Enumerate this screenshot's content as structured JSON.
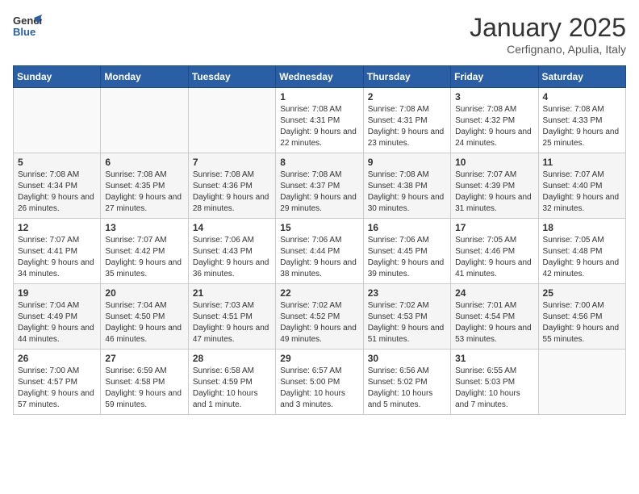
{
  "header": {
    "logo": {
      "general": "General",
      "blue": "Blue"
    },
    "month": "January 2025",
    "location": "Cerfignano, Apulia, Italy"
  },
  "weekdays": [
    "Sunday",
    "Monday",
    "Tuesday",
    "Wednesday",
    "Thursday",
    "Friday",
    "Saturday"
  ],
  "weeks": [
    [
      {
        "day": "",
        "sunrise": "",
        "sunset": "",
        "daylight": ""
      },
      {
        "day": "",
        "sunrise": "",
        "sunset": "",
        "daylight": ""
      },
      {
        "day": "",
        "sunrise": "",
        "sunset": "",
        "daylight": ""
      },
      {
        "day": "1",
        "sunrise": "Sunrise: 7:08 AM",
        "sunset": "Sunset: 4:31 PM",
        "daylight": "Daylight: 9 hours and 22 minutes."
      },
      {
        "day": "2",
        "sunrise": "Sunrise: 7:08 AM",
        "sunset": "Sunset: 4:31 PM",
        "daylight": "Daylight: 9 hours and 23 minutes."
      },
      {
        "day": "3",
        "sunrise": "Sunrise: 7:08 AM",
        "sunset": "Sunset: 4:32 PM",
        "daylight": "Daylight: 9 hours and 24 minutes."
      },
      {
        "day": "4",
        "sunrise": "Sunrise: 7:08 AM",
        "sunset": "Sunset: 4:33 PM",
        "daylight": "Daylight: 9 hours and 25 minutes."
      }
    ],
    [
      {
        "day": "5",
        "sunrise": "Sunrise: 7:08 AM",
        "sunset": "Sunset: 4:34 PM",
        "daylight": "Daylight: 9 hours and 26 minutes."
      },
      {
        "day": "6",
        "sunrise": "Sunrise: 7:08 AM",
        "sunset": "Sunset: 4:35 PM",
        "daylight": "Daylight: 9 hours and 27 minutes."
      },
      {
        "day": "7",
        "sunrise": "Sunrise: 7:08 AM",
        "sunset": "Sunset: 4:36 PM",
        "daylight": "Daylight: 9 hours and 28 minutes."
      },
      {
        "day": "8",
        "sunrise": "Sunrise: 7:08 AM",
        "sunset": "Sunset: 4:37 PM",
        "daylight": "Daylight: 9 hours and 29 minutes."
      },
      {
        "day": "9",
        "sunrise": "Sunrise: 7:08 AM",
        "sunset": "Sunset: 4:38 PM",
        "daylight": "Daylight: 9 hours and 30 minutes."
      },
      {
        "day": "10",
        "sunrise": "Sunrise: 7:07 AM",
        "sunset": "Sunset: 4:39 PM",
        "daylight": "Daylight: 9 hours and 31 minutes."
      },
      {
        "day": "11",
        "sunrise": "Sunrise: 7:07 AM",
        "sunset": "Sunset: 4:40 PM",
        "daylight": "Daylight: 9 hours and 32 minutes."
      }
    ],
    [
      {
        "day": "12",
        "sunrise": "Sunrise: 7:07 AM",
        "sunset": "Sunset: 4:41 PM",
        "daylight": "Daylight: 9 hours and 34 minutes."
      },
      {
        "day": "13",
        "sunrise": "Sunrise: 7:07 AM",
        "sunset": "Sunset: 4:42 PM",
        "daylight": "Daylight: 9 hours and 35 minutes."
      },
      {
        "day": "14",
        "sunrise": "Sunrise: 7:06 AM",
        "sunset": "Sunset: 4:43 PM",
        "daylight": "Daylight: 9 hours and 36 minutes."
      },
      {
        "day": "15",
        "sunrise": "Sunrise: 7:06 AM",
        "sunset": "Sunset: 4:44 PM",
        "daylight": "Daylight: 9 hours and 38 minutes."
      },
      {
        "day": "16",
        "sunrise": "Sunrise: 7:06 AM",
        "sunset": "Sunset: 4:45 PM",
        "daylight": "Daylight: 9 hours and 39 minutes."
      },
      {
        "day": "17",
        "sunrise": "Sunrise: 7:05 AM",
        "sunset": "Sunset: 4:46 PM",
        "daylight": "Daylight: 9 hours and 41 minutes."
      },
      {
        "day": "18",
        "sunrise": "Sunrise: 7:05 AM",
        "sunset": "Sunset: 4:48 PM",
        "daylight": "Daylight: 9 hours and 42 minutes."
      }
    ],
    [
      {
        "day": "19",
        "sunrise": "Sunrise: 7:04 AM",
        "sunset": "Sunset: 4:49 PM",
        "daylight": "Daylight: 9 hours and 44 minutes."
      },
      {
        "day": "20",
        "sunrise": "Sunrise: 7:04 AM",
        "sunset": "Sunset: 4:50 PM",
        "daylight": "Daylight: 9 hours and 46 minutes."
      },
      {
        "day": "21",
        "sunrise": "Sunrise: 7:03 AM",
        "sunset": "Sunset: 4:51 PM",
        "daylight": "Daylight: 9 hours and 47 minutes."
      },
      {
        "day": "22",
        "sunrise": "Sunrise: 7:02 AM",
        "sunset": "Sunset: 4:52 PM",
        "daylight": "Daylight: 9 hours and 49 minutes."
      },
      {
        "day": "23",
        "sunrise": "Sunrise: 7:02 AM",
        "sunset": "Sunset: 4:53 PM",
        "daylight": "Daylight: 9 hours and 51 minutes."
      },
      {
        "day": "24",
        "sunrise": "Sunrise: 7:01 AM",
        "sunset": "Sunset: 4:54 PM",
        "daylight": "Daylight: 9 hours and 53 minutes."
      },
      {
        "day": "25",
        "sunrise": "Sunrise: 7:00 AM",
        "sunset": "Sunset: 4:56 PM",
        "daylight": "Daylight: 9 hours and 55 minutes."
      }
    ],
    [
      {
        "day": "26",
        "sunrise": "Sunrise: 7:00 AM",
        "sunset": "Sunset: 4:57 PM",
        "daylight": "Daylight: 9 hours and 57 minutes."
      },
      {
        "day": "27",
        "sunrise": "Sunrise: 6:59 AM",
        "sunset": "Sunset: 4:58 PM",
        "daylight": "Daylight: 9 hours and 59 minutes."
      },
      {
        "day": "28",
        "sunrise": "Sunrise: 6:58 AM",
        "sunset": "Sunset: 4:59 PM",
        "daylight": "Daylight: 10 hours and 1 minute."
      },
      {
        "day": "29",
        "sunrise": "Sunrise: 6:57 AM",
        "sunset": "Sunset: 5:00 PM",
        "daylight": "Daylight: 10 hours and 3 minutes."
      },
      {
        "day": "30",
        "sunrise": "Sunrise: 6:56 AM",
        "sunset": "Sunset: 5:02 PM",
        "daylight": "Daylight: 10 hours and 5 minutes."
      },
      {
        "day": "31",
        "sunrise": "Sunrise: 6:55 AM",
        "sunset": "Sunset: 5:03 PM",
        "daylight": "Daylight: 10 hours and 7 minutes."
      },
      {
        "day": "",
        "sunrise": "",
        "sunset": "",
        "daylight": ""
      }
    ]
  ]
}
